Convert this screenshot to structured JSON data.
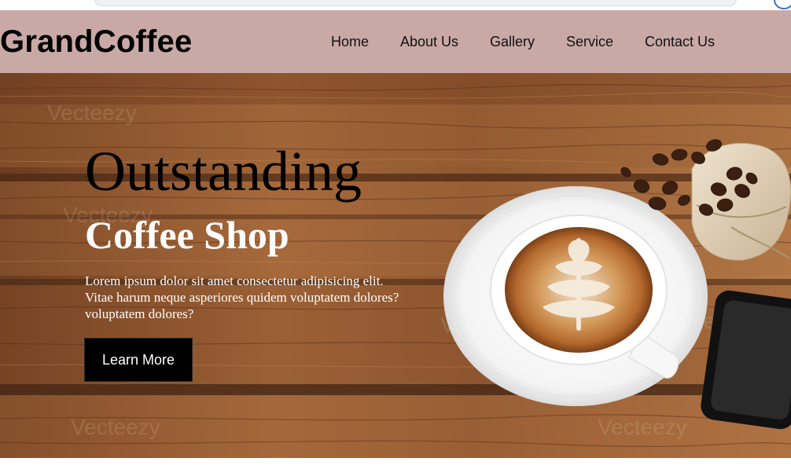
{
  "brand": "GrandCoffee",
  "nav": [
    "Home",
    "About Us",
    "Gallery",
    "Service",
    "Contact Us"
  ],
  "hero": {
    "title": "Outstanding",
    "subtitle": "Coffee Shop",
    "description": "Lorem ipsum dolor sit amet consectetur adipisicing elit. Vitae harum neque asperiores quidem voluptatem dolores?voluptatem dolores?",
    "button_label": "Learn More",
    "watermark": "Vecteezy"
  },
  "colors": {
    "navbar_bg": "#c9a9a6",
    "wood_dark": "#5a321b",
    "wood_mid": "#8a5630",
    "wood_light": "#b07845",
    "button_bg": "#000000",
    "subtitle_color": "#ffffff"
  },
  "icons": [
    "coffee-cup-image",
    "coffee-beans-image",
    "burlap-sack-image",
    "smartphone-image"
  ]
}
